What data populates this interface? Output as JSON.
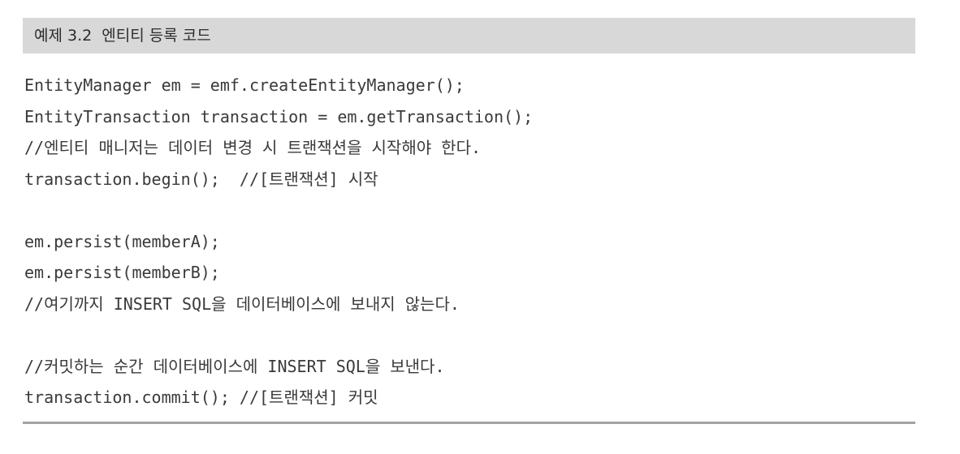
{
  "header": {
    "title": "예제 3.2  엔티티 등록 코드"
  },
  "code_lines": [
    "EntityManager em = emf.createEntityManager();",
    "EntityTransaction transaction = em.getTransaction();",
    "//엔티티 매니저는 데이터 변경 시 트랜잭션을 시작해야 한다.",
    "transaction.begin();  //[트랜잭션] 시작",
    "",
    "em.persist(memberA);",
    "em.persist(memberB);",
    "//여기까지 INSERT SQL을 데이터베이스에 보내지 않는다.",
    "",
    "//커밋하는 순간 데이터베이스에 INSERT SQL을 보낸다.",
    "transaction.commit(); //[트랜잭션] 커밋"
  ]
}
